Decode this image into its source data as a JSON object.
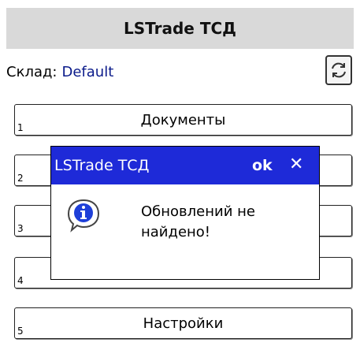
{
  "app": {
    "title": "LSTrade ТСД"
  },
  "warehouse": {
    "label": "Склад:",
    "value": "Default"
  },
  "menu": [
    {
      "num": "1",
      "label": "Документы"
    },
    {
      "num": "2",
      "label": ""
    },
    {
      "num": "3",
      "label": ""
    },
    {
      "num": "4",
      "label": ""
    },
    {
      "num": "5",
      "label": "Настройки"
    }
  ],
  "dialog": {
    "title": "LSTrade ТСД",
    "ok_label": "ok",
    "close_label": "✕",
    "message": "Обновлений не найдено!",
    "icon": "info-icon"
  },
  "colors": {
    "header_bg": "#d9d9d9",
    "dialog_title_bg": "#1e2ad8",
    "warehouse_value": "#0a1a8a"
  }
}
